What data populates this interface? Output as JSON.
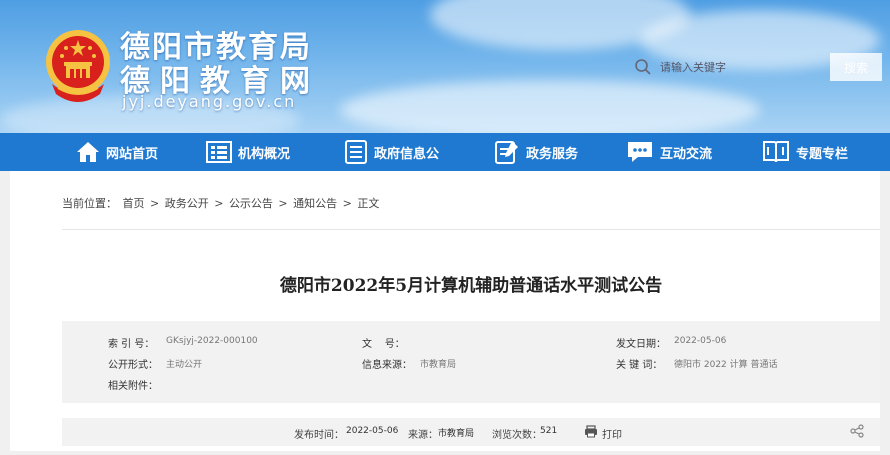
{
  "header": {
    "site_name_line1": "德阳市教育局",
    "site_name_line2": "德阳教育网",
    "domain": "jyj.deyang.gov.cn",
    "search_placeholder": "请输入关键字",
    "search_button": "搜索"
  },
  "nav": {
    "items": [
      {
        "label": "网站首页",
        "icon": "home-icon"
      },
      {
        "label": "机构概况",
        "icon": "org-icon"
      },
      {
        "label": "政府信息公",
        "icon": "document-icon"
      },
      {
        "label": "政务服务",
        "icon": "edit-icon"
      },
      {
        "label": "互动交流",
        "icon": "chat-icon"
      },
      {
        "label": "专题专栏",
        "icon": "book-icon"
      }
    ]
  },
  "breadcrumb": {
    "prefix": "当前位置：",
    "items": [
      "首页",
      "政务公开",
      "公示公告",
      "通知公告",
      "正文"
    ],
    "separator": " > "
  },
  "article": {
    "title": "德阳市2022年5月计算机辅助普通话水平测试公告"
  },
  "meta": {
    "index_label": "索 引 号：",
    "index_value": "GKsjyj-2022-000100",
    "doc_no_label": "文    号：",
    "doc_no_value": "",
    "issue_date_label": "发文日期：",
    "issue_date_value": "2022-05-06",
    "public_form_label": "公开形式：",
    "public_form_value": "主动公开",
    "source_label": "信息来源：",
    "source_value": "市教育局",
    "keywords_label": "关 键 词：",
    "keywords_value": "德阳市 2022 计算 普通话",
    "attachments_label": "相关附件："
  },
  "pub_bar": {
    "publish_time_label": "发布时间：",
    "publish_time_value": "2022-05-06",
    "source_label": "来源：",
    "source_value": "市教育局",
    "views_label": "浏览次数：",
    "views_value": "521",
    "print_label": "打印"
  },
  "colors": {
    "nav_bg": "#1f79d0",
    "banner_top": "#4f9ee3",
    "emblem_red": "#d8201c",
    "emblem_gold": "#f5c242"
  }
}
